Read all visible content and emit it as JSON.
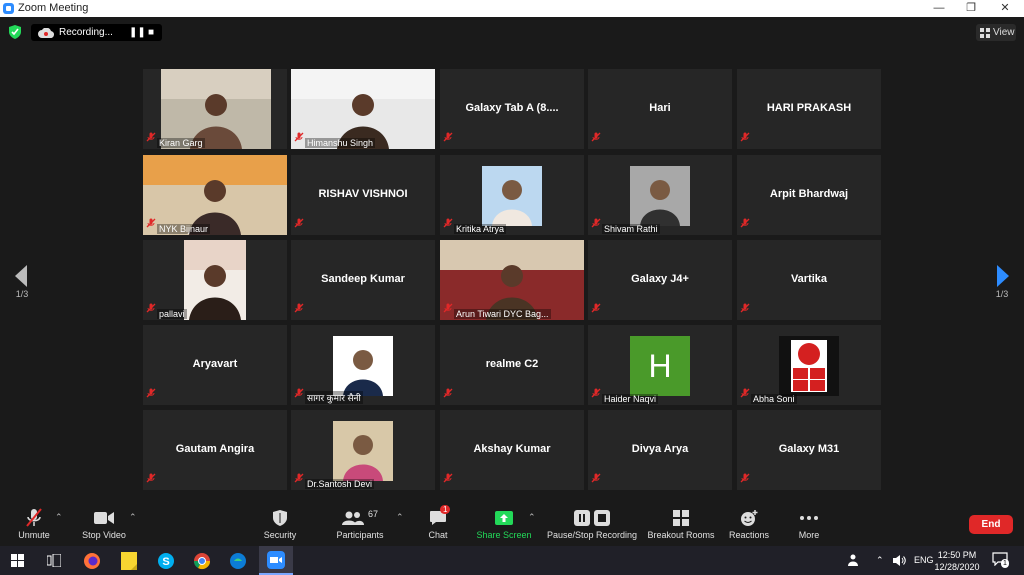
{
  "window": {
    "title": "Zoom Meeting"
  },
  "recording": {
    "label": "Recording..."
  },
  "view": {
    "label": "View"
  },
  "pagination": {
    "left": "1/3",
    "right": "1/3"
  },
  "tiles": [
    {
      "label": "Kiran Garg",
      "type": "video"
    },
    {
      "label": "Himanshu Singh",
      "type": "video"
    },
    {
      "label": "Galaxy Tab A  (8....",
      "type": "name"
    },
    {
      "label": "Hari",
      "type": "name"
    },
    {
      "label": "HARI PRAKASH",
      "type": "name"
    },
    {
      "label": "NYK Bijnaur",
      "type": "video"
    },
    {
      "label": "RISHAV VISHNOI",
      "type": "name"
    },
    {
      "label": "Kritika Atrya",
      "type": "photo"
    },
    {
      "label": "Shivam Rathi",
      "type": "photo"
    },
    {
      "label": "Arpit Bhardwaj",
      "type": "name"
    },
    {
      "label": "pallavi",
      "type": "video"
    },
    {
      "label": "Sandeep Kumar",
      "type": "name"
    },
    {
      "label": "Arun Tiwari DYC Bag...",
      "type": "video",
      "active": true
    },
    {
      "label": "Galaxy J4+",
      "type": "name"
    },
    {
      "label": "Vartika",
      "type": "name"
    },
    {
      "label": "Aryavart",
      "type": "name"
    },
    {
      "label": "सागर कुमार सैनी",
      "type": "photo"
    },
    {
      "label": "realme C2",
      "type": "name"
    },
    {
      "label": "Haider Naqvi",
      "type": "avatar",
      "letter": "H"
    },
    {
      "label": "Abha Soni",
      "type": "logo",
      "logo_text": "NYKS"
    },
    {
      "label": "Gautam Angira",
      "type": "name"
    },
    {
      "label": "Dr.Santosh Devi",
      "type": "photo"
    },
    {
      "label": "Akshay Kumar",
      "type": "name"
    },
    {
      "label": "Divya Arya",
      "type": "name"
    },
    {
      "label": "Galaxy M31",
      "type": "name"
    }
  ],
  "toolbar": {
    "unmute": "Unmute",
    "stop_video": "Stop Video",
    "security": "Security",
    "participants": "Participants",
    "participants_count": "67",
    "chat": "Chat",
    "chat_badge": "1",
    "share": "Share Screen",
    "pause_stop": "Pause/Stop Recording",
    "breakout": "Breakout Rooms",
    "reactions": "Reactions",
    "more": "More",
    "end": "End"
  },
  "taskbar": {
    "lang": "ENG",
    "time": "12:50 PM",
    "date": "12/28/2020",
    "notif_count": "1"
  },
  "colors": {
    "active_border": "#c9e23e",
    "share_green": "#23d959",
    "end_red": "#e02828",
    "avatar_green": "#4a9a2a",
    "muted_red": "#e02828"
  }
}
